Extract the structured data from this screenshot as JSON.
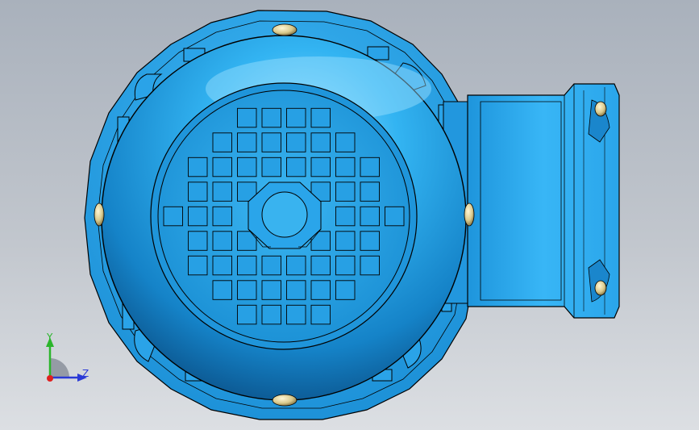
{
  "viewport": {
    "background_top": "#a9b1bc",
    "background_bottom": "#dcdfe3"
  },
  "model": {
    "body_color": "#29a3e6",
    "edge_color": "#000000",
    "shadow_color": "#0a4f86",
    "highlight_color": "#8fdcff",
    "bolt_color": "#d9c98c",
    "fan_grid_rows": 9,
    "fan_grid_cols": 10
  },
  "triad": {
    "y_label": "Y",
    "z_label": "Z",
    "y_color": "#2bb52b",
    "z_color": "#2a3ad6",
    "x_color": "#e02020"
  }
}
